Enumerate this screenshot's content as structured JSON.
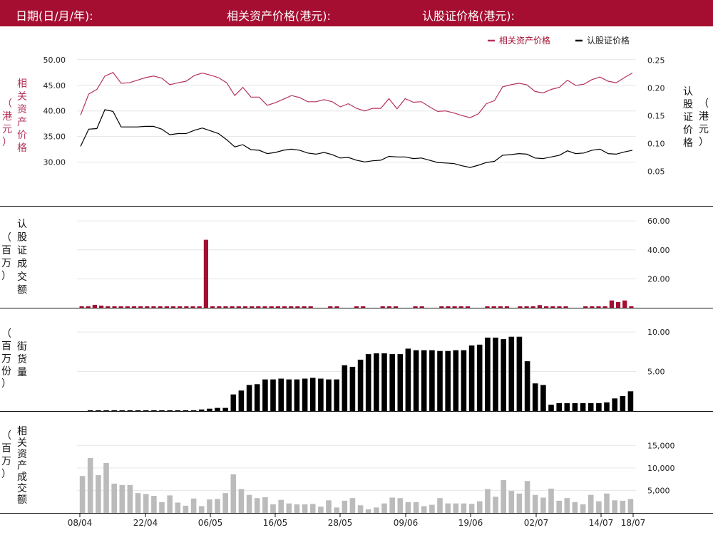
{
  "header": {
    "date_label": "日期(日/月/年):",
    "asset_price_label": "相关资产价格(港元):",
    "warrant_price_label": "认股证价格(港元):"
  },
  "colors": {
    "brand": "#a50d31",
    "asset_line": "#b4335a",
    "warrant_line": "#000000",
    "warrant_turnover_bar": "#a50d31",
    "outstanding_bar": "#000000",
    "asset_turnover_bar": "#bbbbbb",
    "grid": "#e6e6e6"
  },
  "chart_data": [
    {
      "type": "line",
      "panel": "price",
      "legend": [
        "相关资产价格",
        "认股证价格"
      ],
      "legend_position": "top-right",
      "ylabel_left": "相关资产价格（港元）",
      "ylabel_right": "认股证价格（港元）",
      "yticks_left": [
        "50.00",
        "45.00",
        "40.00",
        "35.00",
        "30.00"
      ],
      "yticks_right": [
        "0.25",
        "0.20",
        "0.15",
        "0.10",
        "0.05"
      ],
      "ylim_left": [
        25.5,
        51.5
      ],
      "ylim_right": [
        0.025,
        0.265
      ],
      "x_labels": [
        "08/04",
        "22/04",
        "06/05",
        "16/05",
        "28/05",
        "09/06",
        "19/06",
        "02/07",
        "14/07",
        "18/07"
      ],
      "grid": true,
      "series": [
        {
          "name": "相关资产价格",
          "axis": "left",
          "values": [
            39.2,
            43.3,
            44.2,
            46.8,
            47.5,
            45.4,
            45.5,
            46.0,
            46.5,
            46.8,
            46.4,
            45.1,
            45.5,
            45.8,
            46.9,
            47.4,
            47.0,
            46.5,
            45.5,
            43.0,
            44.6,
            42.7,
            42.7,
            41.1,
            41.6,
            42.3,
            43.0,
            42.6,
            41.8,
            41.8,
            42.2,
            41.8,
            40.8,
            41.4,
            40.5,
            40.0,
            40.5,
            40.5,
            42.4,
            40.4,
            42.4,
            41.7,
            41.8,
            40.8,
            39.9,
            40.0,
            39.6,
            39.1,
            38.7,
            39.4,
            41.4,
            42.0,
            44.7,
            45.1,
            45.4,
            45.1,
            43.8,
            43.5,
            44.2,
            44.6,
            46.0,
            45.0,
            45.2,
            46.1,
            46.6,
            45.8,
            45.5,
            46.5,
            47.4
          ]
        },
        {
          "name": "认股证价格",
          "axis": "right",
          "values": [
            0.095,
            0.126,
            0.127,
            0.161,
            0.158,
            0.13,
            0.13,
            0.13,
            0.131,
            0.131,
            0.126,
            0.116,
            0.118,
            0.118,
            0.124,
            0.128,
            0.123,
            0.118,
            0.107,
            0.094,
            0.098,
            0.089,
            0.088,
            0.082,
            0.084,
            0.088,
            0.09,
            0.088,
            0.083,
            0.081,
            0.084,
            0.08,
            0.074,
            0.075,
            0.07,
            0.067,
            0.069,
            0.07,
            0.077,
            0.076,
            0.076,
            0.073,
            0.074,
            0.07,
            0.066,
            0.065,
            0.064,
            0.06,
            0.057,
            0.061,
            0.066,
            0.068,
            0.079,
            0.08,
            0.082,
            0.081,
            0.074,
            0.073,
            0.076,
            0.079,
            0.087,
            0.082,
            0.083,
            0.088,
            0.09,
            0.082,
            0.081,
            0.085,
            0.088
          ]
        }
      ]
    },
    {
      "type": "bar",
      "panel": "warrant_turnover",
      "ylabel": "认股证成交额（百万）",
      "yticks": [
        "60.00",
        "40.00",
        "20.00"
      ],
      "ylim": [
        0,
        65
      ],
      "grid": true,
      "values": [
        1,
        1,
        2,
        1.5,
        1,
        1,
        1,
        1,
        1,
        1,
        1,
        1,
        1,
        1,
        1,
        1,
        1,
        1,
        1,
        47,
        1,
        1,
        1,
        1,
        1,
        1,
        1,
        1,
        1,
        1,
        1,
        1,
        1,
        1,
        1,
        1,
        0,
        0,
        1,
        1,
        0,
        0,
        1,
        1,
        0,
        0,
        1,
        1,
        1,
        0,
        0,
        1,
        1,
        0,
        0,
        1,
        1,
        1,
        1,
        1,
        0,
        0,
        1,
        1,
        1,
        1,
        0,
        1,
        1,
        1,
        1.8,
        1,
        1,
        1,
        1,
        0,
        0,
        1,
        1,
        1,
        1,
        5,
        4,
        5,
        1
      ]
    },
    {
      "type": "bar",
      "panel": "outstanding",
      "ylabel": "街货量（百万份）",
      "yticks": [
        "10.00",
        "5.00"
      ],
      "ylim": [
        0,
        11
      ],
      "grid": true,
      "values": [
        0,
        0.1,
        0.1,
        0.1,
        0.1,
        0.1,
        0.1,
        0.1,
        0.1,
        0.1,
        0.1,
        0.1,
        0.1,
        0.1,
        0.1,
        0.2,
        0.3,
        0.4,
        0.4,
        2.1,
        2.6,
        3.3,
        3.4,
        4.0,
        4.0,
        4.1,
        4.0,
        4.0,
        4.1,
        4.2,
        4.1,
        4.0,
        4.0,
        5.8,
        5.6,
        6.5,
        7.2,
        7.3,
        7.3,
        7.2,
        7.2,
        7.9,
        7.7,
        7.7,
        7.7,
        7.6,
        7.6,
        7.7,
        7.7,
        8.3,
        8.4,
        9.3,
        9.3,
        9.1,
        9.4,
        9.4,
        6.3,
        3.5,
        3.3,
        0.8,
        1.0,
        1.0,
        1.0,
        1.0,
        1.0,
        1.0,
        1.1,
        1.6,
        1.9,
        2.5
      ]
    },
    {
      "type": "bar",
      "panel": "asset_turnover",
      "ylabel": "相关资产成交额（百万）",
      "yticks": [
        "15,000",
        "10,000",
        "5,000"
      ],
      "ylim": [
        0,
        19000
      ],
      "grid": true,
      "values": [
        8200,
        12200,
        8400,
        11100,
        6500,
        6200,
        6200,
        4400,
        4200,
        3800,
        2400,
        3900,
        2300,
        1600,
        3200,
        1500,
        3000,
        3100,
        4400,
        8600,
        5300,
        4000,
        3300,
        3500,
        1900,
        2900,
        2100,
        1900,
        1900,
        2000,
        1400,
        2800,
        1200,
        2700,
        3300,
        1700,
        800,
        1200,
        2100,
        3400,
        3300,
        2400,
        2400,
        1500,
        1800,
        3300,
        2100,
        2100,
        2100,
        2000,
        2600,
        5300,
        3600,
        7300,
        4900,
        4300,
        7100,
        4000,
        3400,
        5400,
        2700,
        3300,
        2400,
        1900,
        4000,
        2600,
        4300,
        2800,
        2700,
        3100
      ]
    }
  ]
}
